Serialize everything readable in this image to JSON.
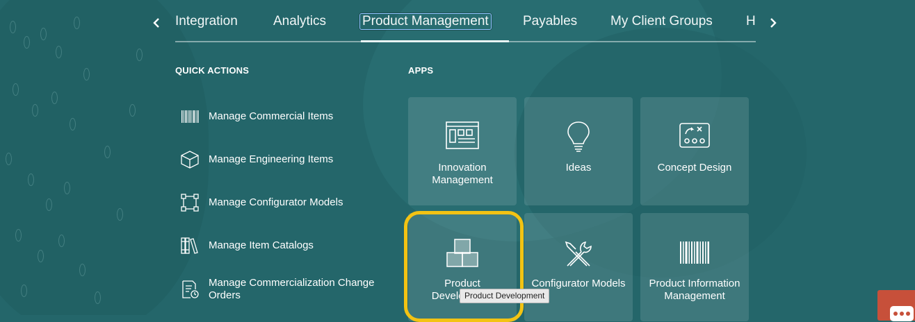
{
  "nav": {
    "tabs": [
      "Integration",
      "Analytics",
      "Product Management",
      "Payables",
      "My Client Groups",
      "Home"
    ],
    "active_tab": "Product Management"
  },
  "quick_actions": {
    "header": "QUICK ACTIONS",
    "items": [
      {
        "label": "Manage Commercial Items",
        "icon": "barcode-icon"
      },
      {
        "label": "Manage Engineering Items",
        "icon": "cube-icon"
      },
      {
        "label": "Manage Configurator Models",
        "icon": "model-nodes-icon"
      },
      {
        "label": "Manage Item Catalogs",
        "icon": "catalog-books-icon"
      },
      {
        "label": "Manage Commercialization Change Orders",
        "icon": "change-order-document-icon"
      }
    ]
  },
  "apps": {
    "header": "APPS",
    "tiles": [
      {
        "label": "Innovation Management",
        "icon": "innovation-dashboard-icon"
      },
      {
        "label": "Ideas",
        "icon": "lightbulb-icon"
      },
      {
        "label": "Concept Design",
        "icon": "concept-design-icon"
      },
      {
        "label": "Product Development",
        "icon": "stacked-boxes-icon"
      },
      {
        "label": "Configurator Models",
        "icon": "tools-icon"
      },
      {
        "label": "Product Information Management",
        "icon": "barcode-icon"
      }
    ]
  },
  "tooltip": "Product Development",
  "colors": {
    "background": "#24666a",
    "highlight": "#f3c313",
    "chat": "#c7503a"
  }
}
